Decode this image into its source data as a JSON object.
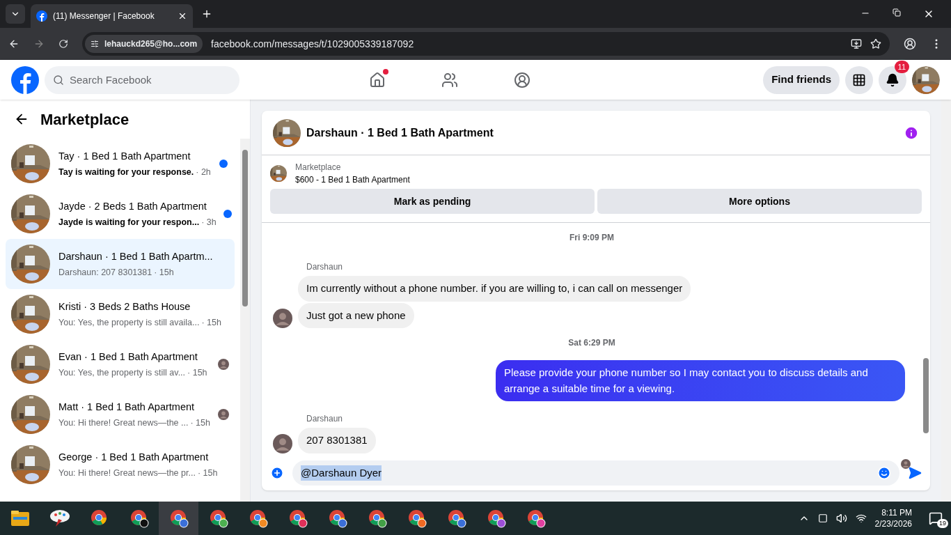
{
  "browser": {
    "tab_title": "(11) Messenger | Facebook",
    "profile_chip": "lehauckd265@ho...com",
    "url": "facebook.com/messages/t/1029005339187092"
  },
  "header": {
    "search_placeholder": "Search Facebook",
    "find_friends": "Find friends",
    "notification_count": "11",
    "nav": [
      {
        "kind": "home",
        "badge": true
      },
      {
        "kind": "friends",
        "badge": false
      },
      {
        "kind": "groups",
        "badge": false
      }
    ]
  },
  "sidebar": {
    "title": "Marketplace",
    "conversations": [
      {
        "title": "Tay · 1 Bed 1 Bath Apartment",
        "preview": "Tay is waiting for your response.",
        "time": "· 2h",
        "unread": true,
        "selected": false,
        "seen": false
      },
      {
        "title": "Jayde · 2 Beds 1 Bath Apartment",
        "preview": "Jayde is waiting for your respon...",
        "time": "· 3h",
        "unread": true,
        "selected": false,
        "seen": false
      },
      {
        "title": "Darshaun · 1 Bed 1 Bath Apartm...",
        "preview": "Darshaun: 207 8301381",
        "time": "· 15h",
        "unread": false,
        "selected": true,
        "seen": false
      },
      {
        "title": "Kristi · 3 Beds 2 Baths House",
        "preview": "You: Yes, the property is still availa...",
        "time": "· 15h",
        "unread": false,
        "selected": false,
        "seen": false
      },
      {
        "title": "Evan · 1 Bed 1 Bath Apartment",
        "preview": "You: Yes, the property is still av...",
        "time": "· 15h",
        "unread": false,
        "selected": false,
        "seen": true
      },
      {
        "title": "Matt · 1 Bed 1 Bath Apartment",
        "preview": "You: Hi there! Great news—the ...",
        "time": "· 15h",
        "unread": false,
        "selected": false,
        "seen": true
      },
      {
        "title": "George · 1 Bed 1 Bath Apartment",
        "preview": "You: Hi there! Great news—the pr...",
        "time": "· 15h",
        "unread": false,
        "selected": false,
        "seen": false
      }
    ]
  },
  "chat": {
    "title": "Darshaun · 1 Bed 1 Bath Apartment",
    "listing_source": "Marketplace",
    "listing": "$600 - 1 Bed 1 Bath Apartment",
    "buttons": [
      "Mark as pending",
      "More options"
    ],
    "messages": [
      {
        "kind": "time",
        "text": "Fri 9:09 PM"
      },
      {
        "kind": "sender",
        "text": "Darshaun"
      },
      {
        "kind": "in",
        "text": "Im currently without a phone  number. if you are willing to, i can call on messenger",
        "avatar": false
      },
      {
        "kind": "in",
        "text": "Just got a new phone",
        "avatar": true
      },
      {
        "kind": "time",
        "text": "Sat 6:29 PM"
      },
      {
        "kind": "out",
        "text": "Please provide your phone number so I may contact you to discuss details and arrange a suitable time for a viewing."
      },
      {
        "kind": "sender",
        "text": "Darshaun"
      },
      {
        "kind": "in",
        "text": "207 8301381",
        "avatar": true
      }
    ],
    "composer_value": "@Darshaun Dyer"
  },
  "taskbar": {
    "apps": [
      {
        "kind": "folder"
      },
      {
        "kind": "paint"
      },
      {
        "kind": "chrome"
      },
      {
        "kind": "chrome",
        "color": "#111111"
      },
      {
        "kind": "chrome",
        "color": "#3b6fd8",
        "selected": true
      },
      {
        "kind": "chrome",
        "color": "#4caf50"
      },
      {
        "kind": "chrome",
        "color": "#f08a24"
      },
      {
        "kind": "chrome",
        "color": "#e0305a"
      },
      {
        "kind": "chrome",
        "color": "#3b6fd8"
      },
      {
        "kind": "chrome",
        "color": "#43a047"
      },
      {
        "kind": "chrome",
        "color": "#f06a24"
      },
      {
        "kind": "chrome",
        "color": "#3b6fd8"
      },
      {
        "kind": "chrome",
        "color": "#9c4fd8"
      },
      {
        "kind": "chrome",
        "color": "#e040a0"
      }
    ],
    "time": "8:11 PM",
    "date": "2/23/2026",
    "notifications": "19"
  }
}
